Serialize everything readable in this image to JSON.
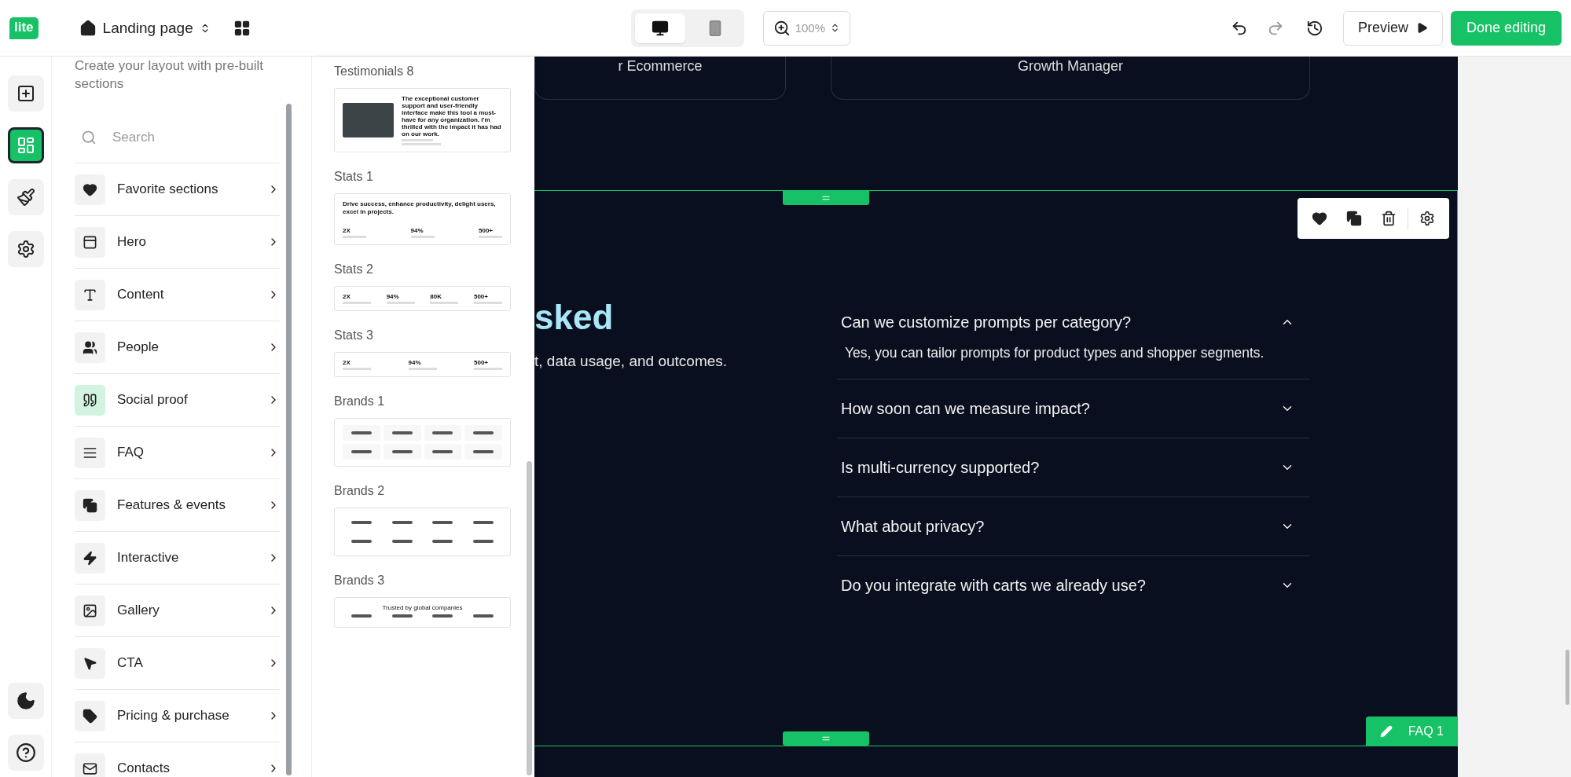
{
  "topbar": {
    "logo": "lite",
    "page_title": "Landing page",
    "devices": [
      {
        "kind": "desktop",
        "selected": true
      },
      {
        "kind": "mobile",
        "selected": false
      }
    ],
    "zoom": "100%",
    "preview": "Preview",
    "done": "Done editing"
  },
  "rail": {
    "items": [
      {
        "kind": "add",
        "selected": false
      },
      {
        "kind": "sections",
        "selected": true
      },
      {
        "kind": "style",
        "selected": false
      },
      {
        "kind": "settings",
        "selected": false
      }
    ],
    "bottom": [
      {
        "kind": "theme"
      },
      {
        "kind": "help"
      }
    ]
  },
  "sections_panel": {
    "intro": "Create your layout with pre-built sections",
    "search_placeholder": "Search",
    "categories": [
      {
        "kind": "favorite",
        "label": "Favorite sections",
        "selected": false
      },
      {
        "kind": "hero",
        "label": "Hero",
        "selected": false
      },
      {
        "kind": "content",
        "label": "Content",
        "selected": false
      },
      {
        "kind": "people",
        "label": "People",
        "selected": false
      },
      {
        "kind": "social",
        "label": "Social proof",
        "selected": true
      },
      {
        "kind": "faq",
        "label": "FAQ",
        "selected": false
      },
      {
        "kind": "features",
        "label": "Features & events",
        "selected": false
      },
      {
        "kind": "interactive",
        "label": "Interactive",
        "selected": false
      },
      {
        "kind": "gallery",
        "label": "Gallery",
        "selected": false
      },
      {
        "kind": "cta",
        "label": "CTA",
        "selected": false
      },
      {
        "kind": "pricing",
        "label": "Pricing & purchase",
        "selected": false
      },
      {
        "kind": "contacts",
        "label": "Contacts",
        "selected": false
      }
    ]
  },
  "templates": [
    {
      "kind": "testimonial",
      "title": "Testimonials 8",
      "quote": "The exceptional customer support and user-friendly interface make this tool a must-have for any organization. I'm thrilled with the impact it has had on our work."
    },
    {
      "kind": "stats_heading",
      "title": "Stats 1",
      "heading": "Drive success, enhance productivity, delight users, excel in projects.",
      "stats": [
        "2X",
        "94%",
        "500+"
      ]
    },
    {
      "kind": "stats_row",
      "title": "Stats 2",
      "stats": [
        "2X",
        "94%",
        "80K",
        "500+"
      ]
    },
    {
      "kind": "stats_icons",
      "title": "Stats 3",
      "stats": [
        "2X",
        "94%",
        "500+"
      ]
    },
    {
      "kind": "brands_grid",
      "title": "Brands 1"
    },
    {
      "kind": "brands_plain",
      "title": "Brands 2"
    },
    {
      "kind": "brands_heading",
      "title": "Brands 3",
      "heading": "Trusted by global companies"
    }
  ],
  "canvas": {
    "cards": [
      "r Ecommerce",
      "Growth Manager"
    ],
    "heading": "sked",
    "subheading": "t, data usage, and outcomes.",
    "faq": [
      {
        "question": "Can we customize prompts per category?",
        "expanded": true,
        "answer": "Yes, you can tailor prompts for product types and shopper segments."
      },
      {
        "question": "How soon can we measure impact?",
        "expanded": false
      },
      {
        "question": "Is multi-currency supported?",
        "expanded": false
      },
      {
        "question": "What about privacy?",
        "expanded": false
      },
      {
        "question": "Do you integrate with carts we already use?",
        "expanded": false
      }
    ],
    "section_label": "FAQ 1"
  }
}
